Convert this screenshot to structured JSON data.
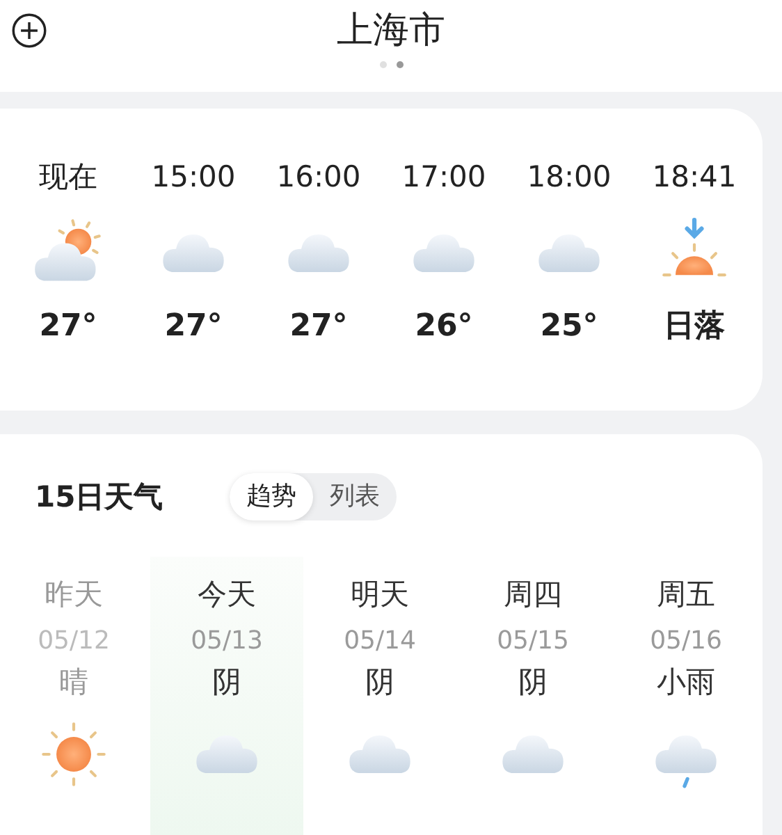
{
  "header": {
    "title": "上海市",
    "pages": [
      {
        "selected": false
      },
      {
        "selected": true
      }
    ]
  },
  "hourly": [
    {
      "time": "现在",
      "kind": "partly_cloudy",
      "temp": "27°"
    },
    {
      "time": "15:00",
      "kind": "cloudy",
      "temp": "27°"
    },
    {
      "time": "16:00",
      "kind": "cloudy",
      "temp": "27°"
    },
    {
      "time": "17:00",
      "kind": "cloudy",
      "temp": "26°"
    },
    {
      "time": "18:00",
      "kind": "cloudy",
      "temp": "25°"
    },
    {
      "time": "18:41",
      "kind": "sunset",
      "temp": "日落"
    }
  ],
  "forecast": {
    "title": "15日天气",
    "tabs": [
      {
        "label": "趋势",
        "selected": true
      },
      {
        "label": "列表",
        "selected": false
      }
    ],
    "days": [
      {
        "day": "昨天",
        "date": "05/12",
        "condition": "晴",
        "kind": "sunny",
        "past": true,
        "selected": false
      },
      {
        "day": "今天",
        "date": "05/13",
        "condition": "阴",
        "kind": "cloudy",
        "past": false,
        "selected": true
      },
      {
        "day": "明天",
        "date": "05/14",
        "condition": "阴",
        "kind": "cloudy",
        "past": false,
        "selected": false
      },
      {
        "day": "周四",
        "date": "05/15",
        "condition": "阴",
        "kind": "cloudy",
        "past": false,
        "selected": false
      },
      {
        "day": "周五",
        "date": "05/16",
        "condition": "小雨",
        "kind": "rain",
        "past": false,
        "selected": false
      }
    ]
  }
}
